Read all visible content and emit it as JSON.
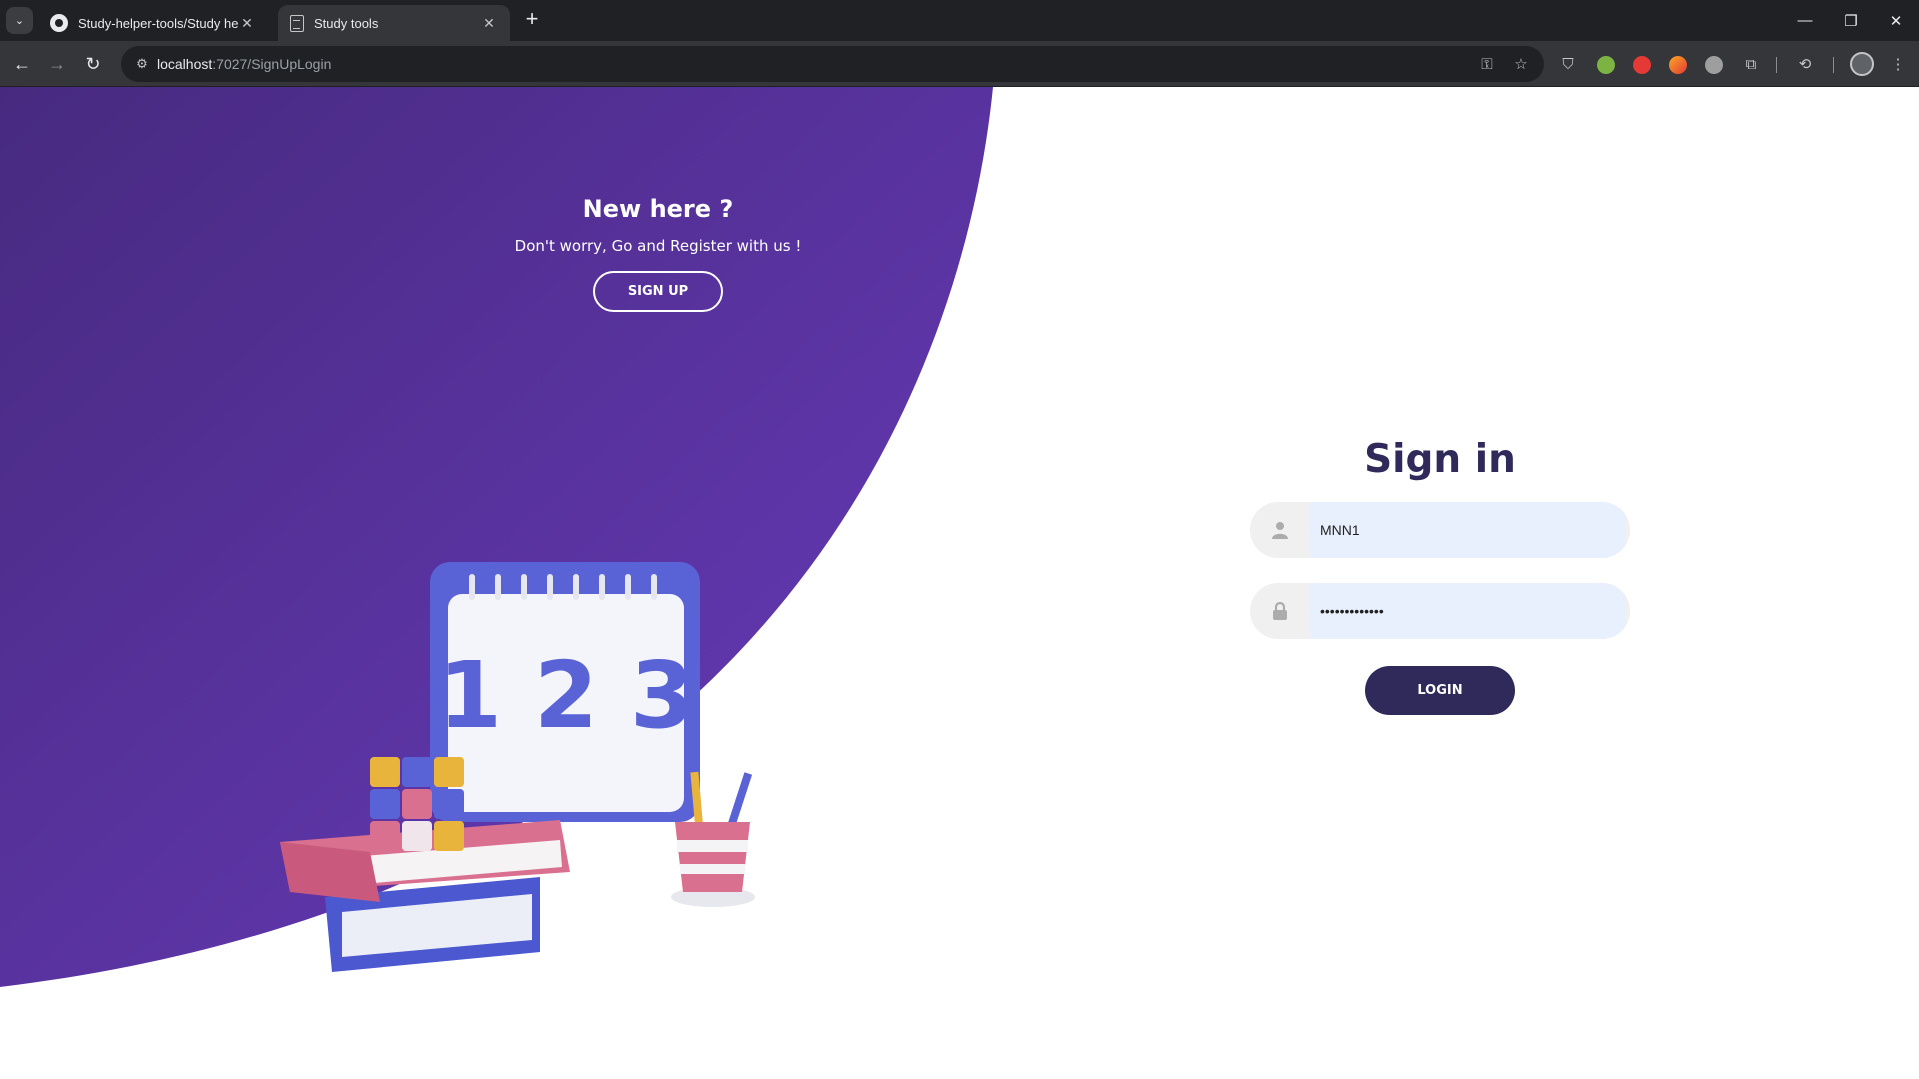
{
  "browser": {
    "tabs": [
      {
        "title": "Study-helper-tools/Study helpe",
        "icon": "github-icon",
        "active": false
      },
      {
        "title": "Study tools",
        "icon": "document-icon",
        "active": true
      }
    ],
    "url_host": "localhost",
    "url_path": ":7027/SignUpLogin"
  },
  "colors": {
    "purple_dark": "#4a2c82",
    "purple_light": "#6a3bbd",
    "navy": "#302a5b",
    "input_bg": "#e8effd"
  },
  "signup_panel": {
    "heading": "New here ?",
    "text": "Don't worry, Go and Register with us !",
    "button_label": "SIGN UP"
  },
  "signin_form": {
    "title": "Sign in",
    "username_value": "MNN1",
    "password_value": "•••••••••••••",
    "login_label": "LOGIN"
  },
  "illustration": {
    "calendar_text": "1 2 3"
  }
}
